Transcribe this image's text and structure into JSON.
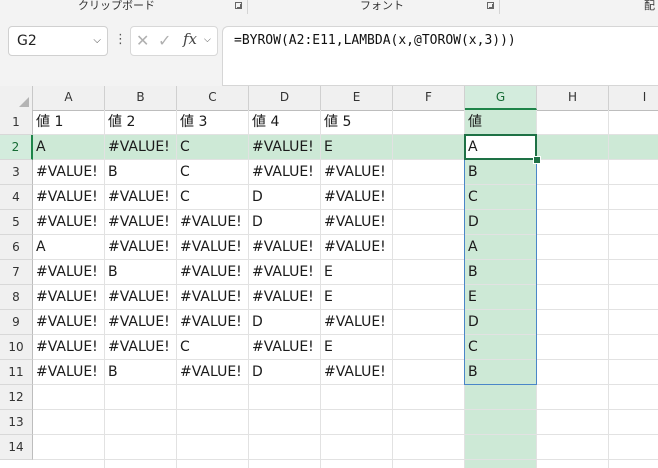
{
  "ribbon": {
    "groups": [
      {
        "label": "クリップボード"
      },
      {
        "label": "フォント"
      },
      {
        "label": "配"
      }
    ]
  },
  "formula_bar": {
    "name_box": "G2",
    "more_icon": "⋮",
    "cancel_icon": "✕",
    "enter_icon": "✓",
    "fx_icon": "fx",
    "formula": "=BYROW(A2:E11,LAMBDA(x,@TOROW(x,3)))"
  },
  "sheet": {
    "columns": [
      "A",
      "B",
      "C",
      "D",
      "E",
      "F",
      "G",
      "H",
      "I"
    ],
    "selected_column": "G",
    "row_numbers": [
      "1",
      "2",
      "3",
      "4",
      "5",
      "6",
      "7",
      "8",
      "9",
      "10",
      "11",
      "12",
      "13",
      "14"
    ],
    "selected_row": "2",
    "active_cell": "G2",
    "headers": {
      "A": "値 1",
      "B": "値 2",
      "C": "値 3",
      "D": "値 4",
      "E": "値 5",
      "G": "値"
    },
    "rows": [
      {
        "A": "A",
        "B": "#VALUE!",
        "C": "C",
        "D": "#VALUE!",
        "E": "E",
        "G": "A"
      },
      {
        "A": "#VALUE!",
        "B": "B",
        "C": "C",
        "D": "#VALUE!",
        "E": "#VALUE!",
        "G": "B"
      },
      {
        "A": "#VALUE!",
        "B": "#VALUE!",
        "C": "C",
        "D": "D",
        "E": "#VALUE!",
        "G": "C"
      },
      {
        "A": "#VALUE!",
        "B": "#VALUE!",
        "C": "#VALUE!",
        "D": "D",
        "E": "#VALUE!",
        "G": "D"
      },
      {
        "A": "A",
        "B": "#VALUE!",
        "C": "#VALUE!",
        "D": "#VALUE!",
        "E": "#VALUE!",
        "G": "A"
      },
      {
        "A": "#VALUE!",
        "B": "B",
        "C": "#VALUE!",
        "D": "#VALUE!",
        "E": "E",
        "G": "B"
      },
      {
        "A": "#VALUE!",
        "B": "#VALUE!",
        "C": "#VALUE!",
        "D": "#VALUE!",
        "E": "E",
        "G": "E"
      },
      {
        "A": "#VALUE!",
        "B": "#VALUE!",
        "C": "#VALUE!",
        "D": "D",
        "E": "#VALUE!",
        "G": "D"
      },
      {
        "A": "#VALUE!",
        "B": "#VALUE!",
        "C": "C",
        "D": "#VALUE!",
        "E": "E",
        "G": "C"
      },
      {
        "A": "#VALUE!",
        "B": "B",
        "C": "#VALUE!",
        "D": "D",
        "E": "#VALUE!",
        "G": "B"
      }
    ]
  }
}
